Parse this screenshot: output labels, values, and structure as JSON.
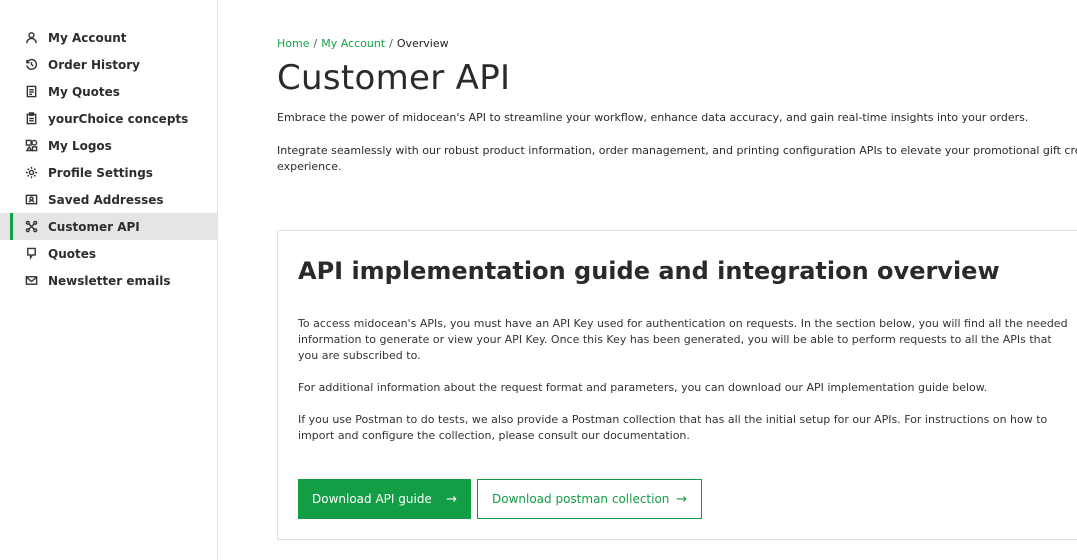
{
  "sidebar": {
    "items": [
      {
        "label": "My Account",
        "icon": "user-icon"
      },
      {
        "label": "Order History",
        "icon": "history-icon"
      },
      {
        "label": "My Quotes",
        "icon": "document-icon"
      },
      {
        "label": "yourChoice concepts",
        "icon": "clipboard-icon"
      },
      {
        "label": "My Logos",
        "icon": "logos-icon"
      },
      {
        "label": "Profile Settings",
        "icon": "gear-icon"
      },
      {
        "label": "Saved Addresses",
        "icon": "address-card-icon"
      },
      {
        "label": "Customer API",
        "icon": "api-icon",
        "active": true
      },
      {
        "label": "Quotes",
        "icon": "quote-icon"
      },
      {
        "label": "Newsletter emails",
        "icon": "envelope-icon"
      }
    ]
  },
  "breadcrumb": {
    "home": "Home",
    "separator": "/",
    "account": "My Account",
    "current": "Overview"
  },
  "main": {
    "title": "Customer API",
    "intro_1": "Embrace the power of midocean's API to streamline your workflow, enhance data accuracy, and gain real-time insights into your orders.",
    "intro_2a": "Integrate seamlessly with our robust product information, order management, and printing configuration APIs to elevate your promotional gift creatio",
    "intro_2b": "experience."
  },
  "card": {
    "title": "API implementation guide and integration overview",
    "p1": "To access midocean's APIs, you must have an API Key used for authentication on requests. In the section below, you will find all the needed information to generate or view your API Key. Once this Key has been generated, you will be able to perform requests to all the APIs that you are subscribed to.",
    "p2": "For additional information about the request format and parameters, you can download our API implementation guide below.",
    "p3": "If you use Postman to do tests, we also provide a Postman collection that has all the initial setup for our APIs. For instructions on how to import and configure the collection, please consult our documentation.",
    "download_guide_label": "Download API guide",
    "download_postman_label": "Download postman collection",
    "arrow": "→"
  },
  "colors": {
    "accent": "#139d45",
    "link": "#15a148",
    "active_bg": "#e5e5e5"
  }
}
